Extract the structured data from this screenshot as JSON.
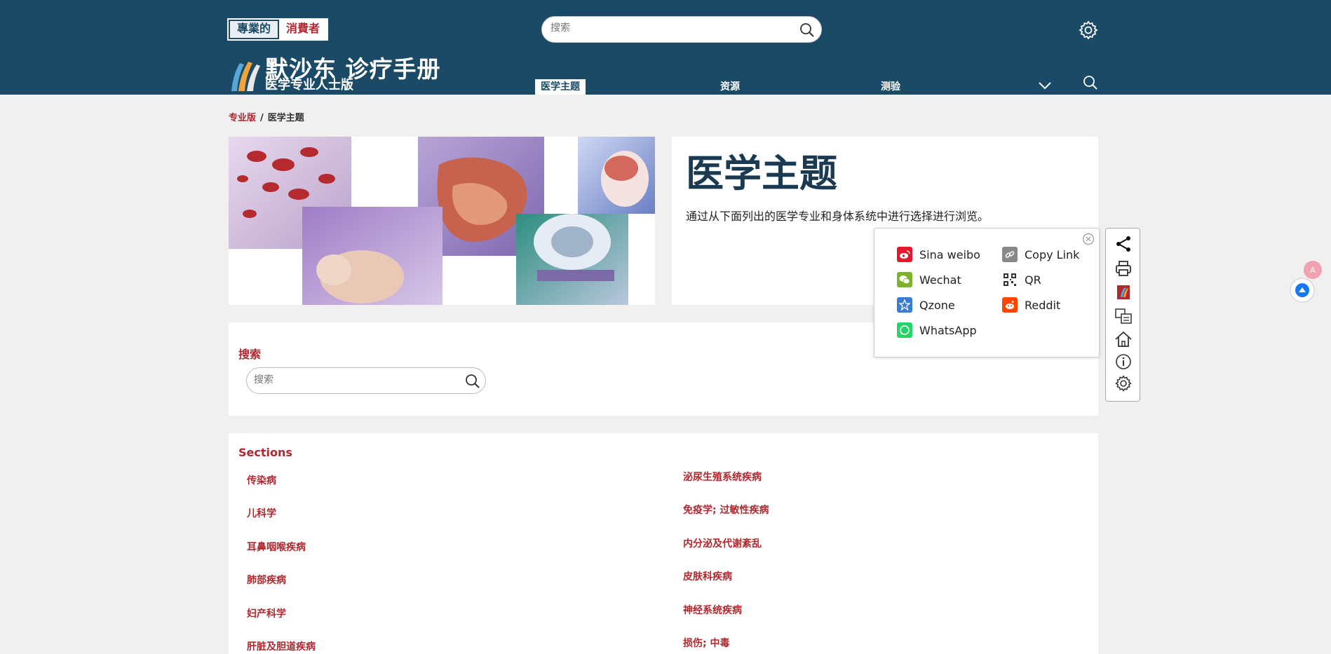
{
  "header": {
    "audience": {
      "professional": "專業的",
      "consumer": "消費者"
    },
    "search_placeholder": "搜索",
    "brand_title": "默沙东 诊疗手册",
    "brand_subtitle": "医学专业人士版",
    "nav": [
      "医学主题",
      "资源",
      "测验"
    ],
    "colors": {
      "bar": "#1a4a66",
      "accent": "#b0282d"
    }
  },
  "breadcrumb": {
    "home": "专业版",
    "separator": "/",
    "current": "医学主题"
  },
  "hero": {
    "title": "医学主题",
    "description": "通过从下面列出的医学专业和身体系统中进行选择进行浏览。"
  },
  "search": {
    "label": "搜索",
    "placeholder": "搜索"
  },
  "sections": {
    "label": "Sections",
    "left": [
      "传染病",
      "儿科学",
      "耳鼻咽喉疾病",
      "肺部疾病",
      "妇产科学",
      "肝脏及胆道疾病"
    ],
    "right": [
      "泌尿生殖系统疾病",
      "免疫学; 过敏性疾病",
      "内分泌及代谢紊乱",
      "皮肤科疾病",
      "神经系统疾病",
      "损伤; 中毒"
    ]
  },
  "share": {
    "items": [
      {
        "label": "Sina weibo",
        "icon": "weibo-icon",
        "color": "#e6162d"
      },
      {
        "label": "Copy Link",
        "icon": "link-icon",
        "color": "#888888"
      },
      {
        "label": "Wechat",
        "icon": "wechat-icon",
        "color": "#7bb32e"
      },
      {
        "label": "QR",
        "icon": "qr-icon",
        "color": "#333333"
      },
      {
        "label": "Qzone",
        "icon": "qzone-icon",
        "color": "#3a7bd5"
      },
      {
        "label": "Reddit",
        "icon": "reddit-icon",
        "color": "#ff4500"
      },
      {
        "label": "WhatsApp",
        "icon": "whatsapp-icon",
        "color": "#25d366"
      }
    ]
  },
  "side_toolbar": [
    "share-icon",
    "print-icon",
    "manual-icon",
    "translate-icon",
    "home-icon",
    "info-icon",
    "gear-icon"
  ]
}
